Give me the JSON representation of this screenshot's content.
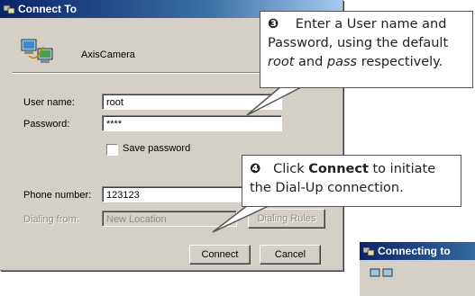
{
  "dialog": {
    "title": "Connect To",
    "connection_name": "AxisCamera",
    "username_label": "User name:",
    "username_value": "root",
    "password_label": "Password:",
    "password_value": "****",
    "save_password_label": "Save password",
    "phone_label": "Phone number:",
    "phone_value": "123123",
    "dialing_from_label": "Dialing from:",
    "dialing_from_value": "New Location",
    "dialing_rules_label": "Dialing Rules",
    "connect_label": "Connect",
    "cancel_label": "Cancel"
  },
  "callouts": {
    "step3_number": "❸",
    "step3_text_a": "Enter a User name and Password, using the default ",
    "step3_root": "root",
    "step3_and": " and ",
    "step3_pass": "pass",
    "step3_end": " respectively.",
    "step4_number": "❹",
    "step4_text_a": "Click ",
    "step4_connect": "Connect",
    "step4_text_b": " to initiate the Dial-Up connection."
  },
  "second_window": {
    "title": "Connecting to"
  },
  "colors": {
    "titlebar_start": "#0a246a",
    "titlebar_end": "#a6caf0",
    "dialog_bg": "#d4d0c8"
  }
}
